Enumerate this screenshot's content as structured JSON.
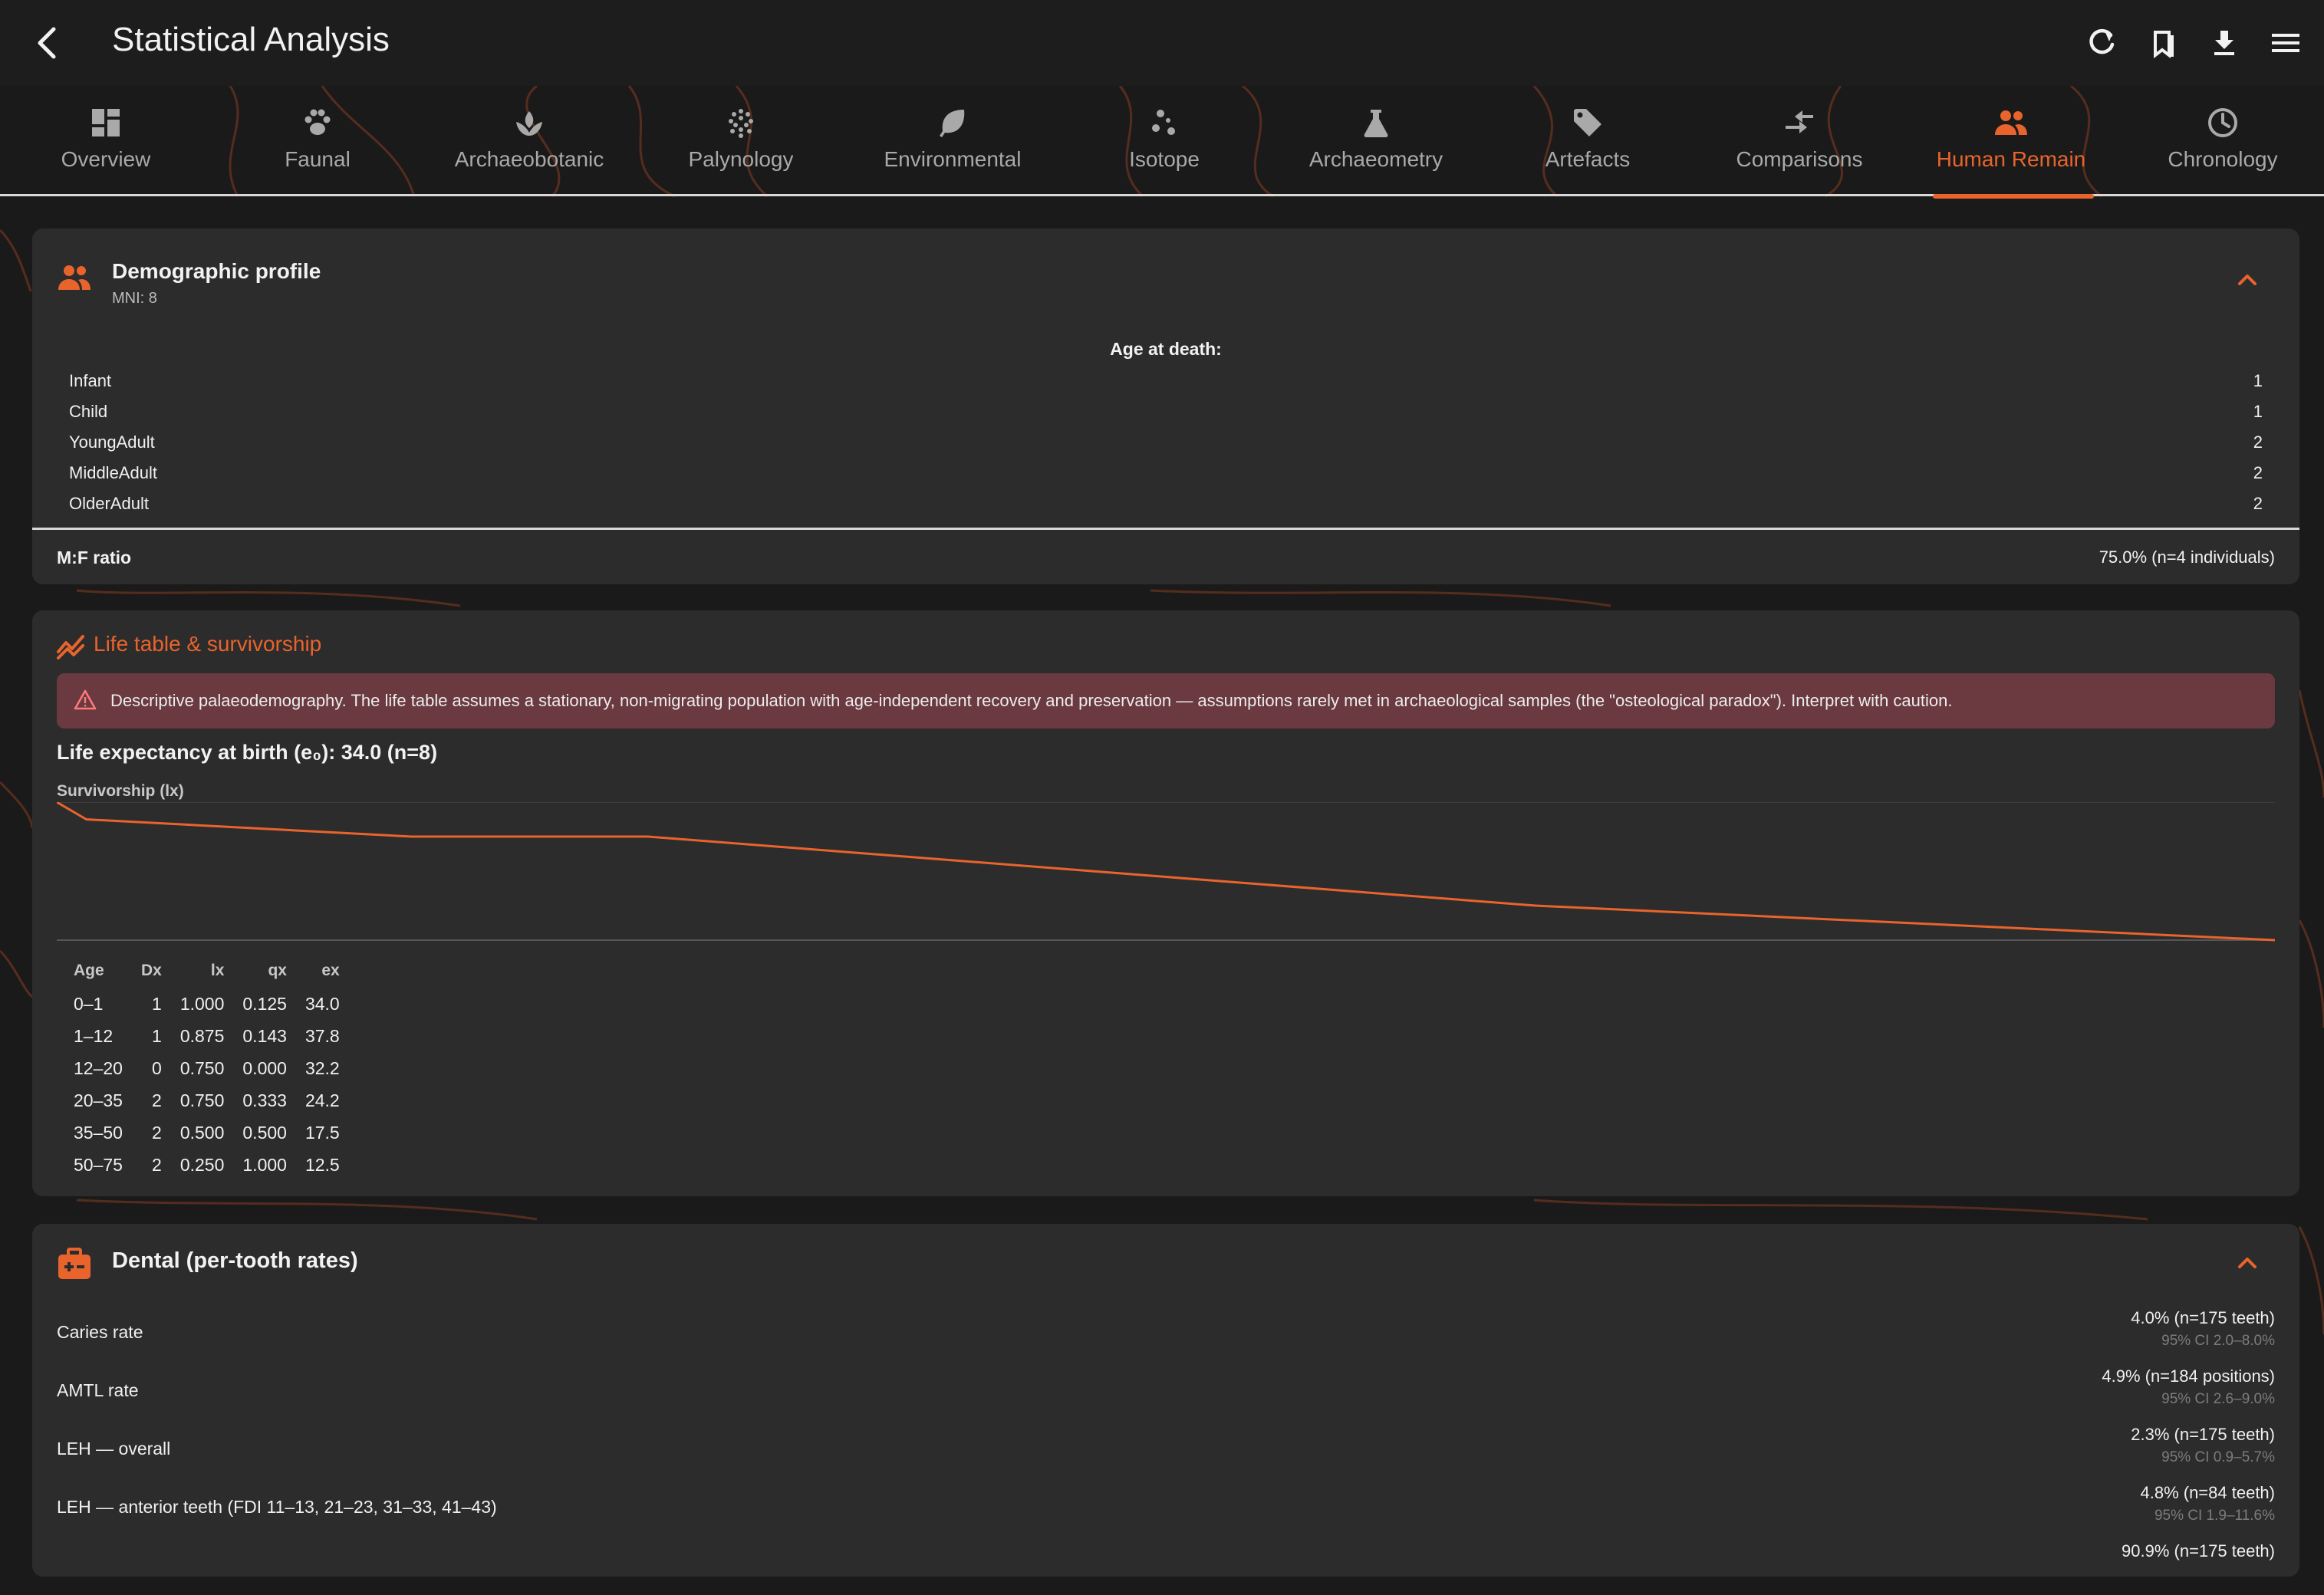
{
  "app_bar": {
    "title": "Statistical Analysis",
    "actions": [
      "refresh-icon",
      "bookmarks-icon",
      "download-icon",
      "menu-icon"
    ]
  },
  "tabs": [
    {
      "label": "Overview",
      "icon": "dashboard-icon"
    },
    {
      "label": "Faunal",
      "icon": "paw-icon"
    },
    {
      "label": "Archaeobotanic",
      "icon": "plant-icon"
    },
    {
      "label": "Palynology",
      "icon": "pollen-icon"
    },
    {
      "label": "Environmental",
      "icon": "leaf-icon"
    },
    {
      "label": "Isotope",
      "icon": "isotope-icon"
    },
    {
      "label": "Archaeometry",
      "icon": "flask-icon"
    },
    {
      "label": "Artefacts",
      "icon": "tag-icon"
    },
    {
      "label": "Comparisons",
      "icon": "compare-arrows-icon"
    },
    {
      "label": "Human Remain",
      "icon": "people-icon",
      "active": true
    },
    {
      "label": "Chronology",
      "icon": "clock-icon"
    }
  ],
  "demographic": {
    "title": "Demographic profile",
    "subtitle": "MNI: 8",
    "age_heading": "Age at death:",
    "ages": [
      {
        "label": "Infant",
        "count": "1"
      },
      {
        "label": "Child",
        "count": "1"
      },
      {
        "label": "YoungAdult",
        "count": "2"
      },
      {
        "label": "MiddleAdult",
        "count": "2"
      },
      {
        "label": "OlderAdult",
        "count": "2"
      }
    ],
    "mf_label": "M:F ratio",
    "mf_value": "75.0% (n=4 individuals)"
  },
  "life_table": {
    "title": "Life table & survivorship",
    "warning": "Descriptive palaeodemography. The life table assumes a stationary, non-migrating population with age-independent recovery and preservation — assumptions rarely met in archaeological samples (the \"osteological paradox\"). Interpret with caution.",
    "life_expectancy": "Life expectancy at birth (e₀): 34.0 (n=8)",
    "chart_label": "Survivorship (lx)",
    "columns": [
      "Age",
      "Dx",
      "lx",
      "qx",
      "ex"
    ],
    "rows": [
      [
        "0–1",
        "1",
        "1.000",
        "0.125",
        "34.0"
      ],
      [
        "1–12",
        "1",
        "0.875",
        "0.143",
        "37.8"
      ],
      [
        "12–20",
        "0",
        "0.750",
        "0.000",
        "32.2"
      ],
      [
        "20–35",
        "2",
        "0.750",
        "0.333",
        "24.2"
      ],
      [
        "35–50",
        "2",
        "0.500",
        "0.500",
        "17.5"
      ],
      [
        "50–75",
        "2",
        "0.250",
        "1.000",
        "12.5"
      ]
    ]
  },
  "chart_data": {
    "type": "line",
    "title": "Survivorship (lx)",
    "x": [
      0,
      1,
      12,
      20,
      35,
      50,
      75
    ],
    "series": [
      {
        "values": [
          1.0,
          0.875,
          0.75,
          0.75,
          0.5,
          0.25,
          0.0
        ]
      }
    ],
    "xlim": [
      0,
      75
    ],
    "ylim": [
      0,
      1
    ],
    "grid": true
  },
  "dental": {
    "title": "Dental (per-tooth rates)",
    "rows": [
      {
        "label": "Caries rate",
        "value": "4.0% (n=175 teeth)",
        "ci": "95% CI 2.0–8.0%"
      },
      {
        "label": "AMTL rate",
        "value": "4.9% (n=184 positions)",
        "ci": "95% CI 2.6–9.0%"
      },
      {
        "label": "LEH — overall",
        "value": "2.3% (n=175 teeth)",
        "ci": "95% CI 0.9–5.7%"
      },
      {
        "label": "LEH — anterior teeth (FDI 11–13, 21–23, 31–33, 41–43)",
        "value": "4.8% (n=84 teeth)",
        "ci": "95% CI 1.9–11.6%"
      },
      {
        "label": "",
        "value": "90.9% (n=175 teeth)",
        "ci": ""
      }
    ]
  },
  "colors": {
    "accent": "#e8642c",
    "background": "#1b1a1a",
    "card": "#2c2c2c",
    "warning_bg": "#6a3a40"
  }
}
